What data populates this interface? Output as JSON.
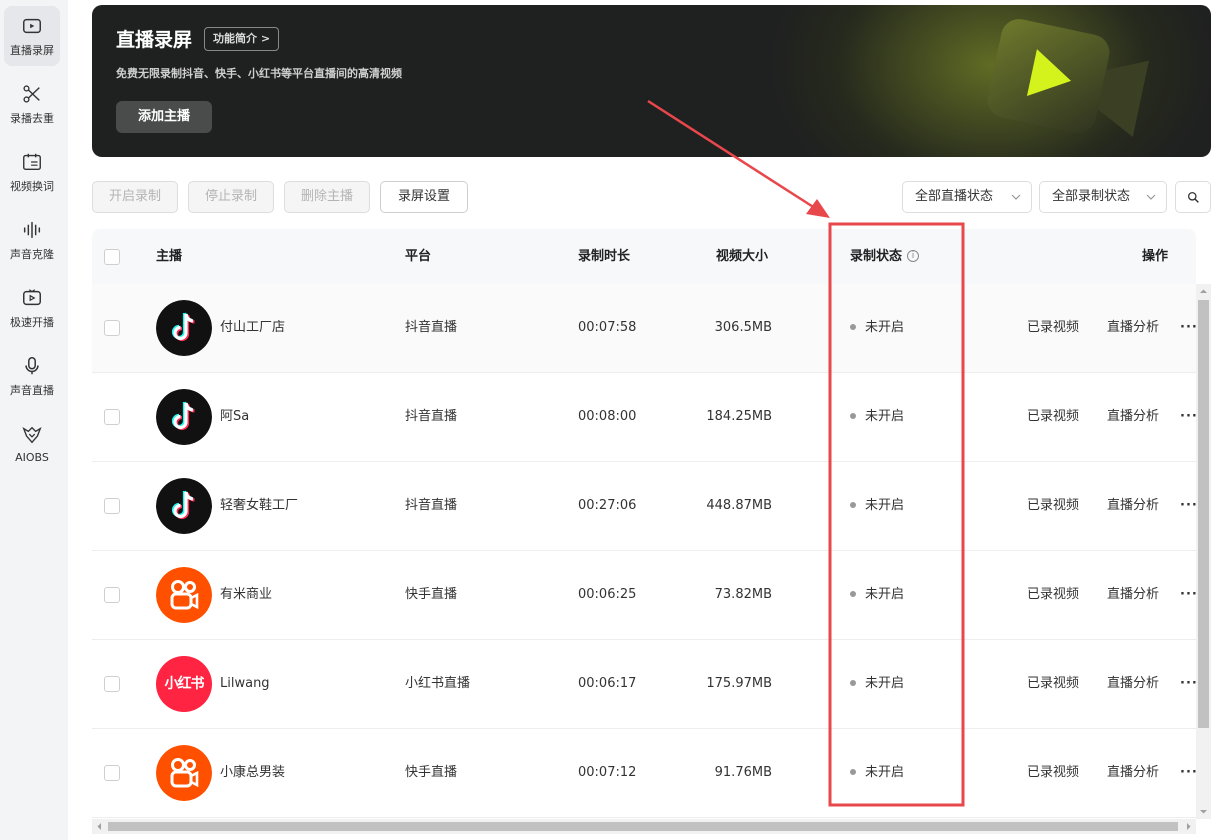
{
  "sidebar": {
    "items": [
      {
        "label": "直播录屏",
        "icon": "tv-icon",
        "active": true
      },
      {
        "label": "录播去重",
        "icon": "scissors-icon",
        "active": false
      },
      {
        "label": "视频换词",
        "icon": "word-swap-icon",
        "active": false
      },
      {
        "label": "声音克隆",
        "icon": "waveform-icon",
        "active": false
      },
      {
        "label": "极速开播",
        "icon": "play-screen-icon",
        "active": false
      },
      {
        "label": "声音直播",
        "icon": "microphone-icon",
        "active": false
      },
      {
        "label": "AIOBS",
        "icon": "aiobs-logo-icon",
        "active": false
      }
    ]
  },
  "banner": {
    "title": "直播录屏",
    "feature_link": "功能简介 >",
    "subtitle": "免费无限录制抖音、快手、小红书等平台直播间的高清视频",
    "add_host_label": "添加主播"
  },
  "toolbar": {
    "start_record": "开启录制",
    "stop_record": "停止录制",
    "delete_host": "删除主播",
    "record_settings": "录屏设置",
    "live_status_filter": "全部直播状态",
    "record_status_filter": "全部录制状态"
  },
  "table": {
    "headers": {
      "host": "主播",
      "platform": "平台",
      "duration": "录制时长",
      "size": "视频大小",
      "status": "录制状态",
      "status_info": "i",
      "actions": "操作"
    },
    "rows": [
      {
        "name": "付山工厂店",
        "platform": "抖音直播",
        "duration": "00:07:58",
        "size": "306.5MB",
        "status": "未开启",
        "action1": "已录视频",
        "action2": "直播分析",
        "more": "···",
        "logo": "douyin"
      },
      {
        "name": "阿Sa",
        "platform": "抖音直播",
        "duration": "00:08:00",
        "size": "184.25MB",
        "status": "未开启",
        "action1": "已录视频",
        "action2": "直播分析",
        "more": "···",
        "logo": "douyin"
      },
      {
        "name": "轻奢女鞋工厂",
        "platform": "抖音直播",
        "duration": "00:27:06",
        "size": "448.87MB",
        "status": "未开启",
        "action1": "已录视频",
        "action2": "直播分析",
        "more": "···",
        "logo": "douyin"
      },
      {
        "name": "有米商业",
        "platform": "快手直播",
        "duration": "00:06:25",
        "size": "73.82MB",
        "status": "未开启",
        "action1": "已录视频",
        "action2": "直播分析",
        "more": "···",
        "logo": "kuaishou"
      },
      {
        "name": "Lilwang",
        "platform": "小红书直播",
        "duration": "00:06:17",
        "size": "175.97MB",
        "status": "未开启",
        "action1": "已录视频",
        "action2": "直播分析",
        "more": "···",
        "logo": "xiaohongshu",
        "logo_text": "小红书"
      },
      {
        "name": "小康总男装",
        "platform": "快手直播",
        "duration": "00:07:12",
        "size": "91.76MB",
        "status": "未开启",
        "action1": "已录视频",
        "action2": "直播分析",
        "more": "···",
        "logo": "kuaishou"
      }
    ]
  },
  "colors": {
    "link": "#1677ff",
    "annotation": "#e8474b",
    "banner_bg": "#1f2020",
    "accent_lime": "#d4f31c"
  }
}
